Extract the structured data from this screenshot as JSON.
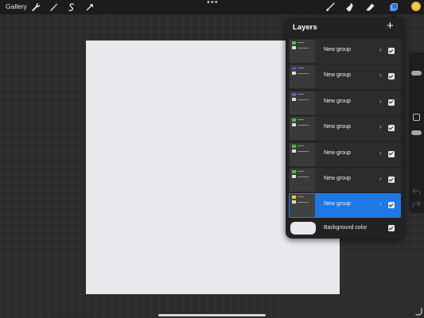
{
  "topbar": {
    "gallery_label": "Gallery",
    "left_tools": [
      "wrench-icon",
      "magic-wand-icon",
      "selection-icon",
      "transform-arrow-icon"
    ],
    "right_tools": [
      "brush-icon",
      "smudge-icon",
      "eraser-icon",
      "layers-icon"
    ],
    "more_dots": "•••",
    "current_color": "#f6c945"
  },
  "canvas": {
    "color": "#e9e8ec"
  },
  "layers_panel": {
    "title": "Layers",
    "add_button": "+",
    "layers": [
      {
        "name": "New group",
        "chevron": "›",
        "visible": true,
        "selected": false,
        "thumb_color": "#3ec43e"
      },
      {
        "name": "New group",
        "chevron": "›",
        "visible": true,
        "selected": false,
        "thumb_color": "#3b57c9"
      },
      {
        "name": "New group",
        "chevron": "›",
        "visible": true,
        "selected": false,
        "thumb_color": "#5566cc"
      },
      {
        "name": "New group",
        "chevron": "›",
        "visible": true,
        "selected": false,
        "thumb_color": "#3ec43e"
      },
      {
        "name": "New group",
        "chevron": "›",
        "visible": true,
        "selected": false,
        "thumb_color": "#3ec43e"
      },
      {
        "name": "New group",
        "chevron": "›",
        "visible": true,
        "selected": false,
        "thumb_color": "#3ec43e"
      },
      {
        "name": "New group",
        "chevron": "›",
        "visible": true,
        "selected": true,
        "thumb_color": "#f2c230"
      }
    ],
    "background": {
      "label": "Background color",
      "color": "#e9e8ec",
      "visible": true
    }
  },
  "colors": {
    "accent": "#1e79e6",
    "panel": "#222222",
    "row": "#2c2c2c"
  }
}
